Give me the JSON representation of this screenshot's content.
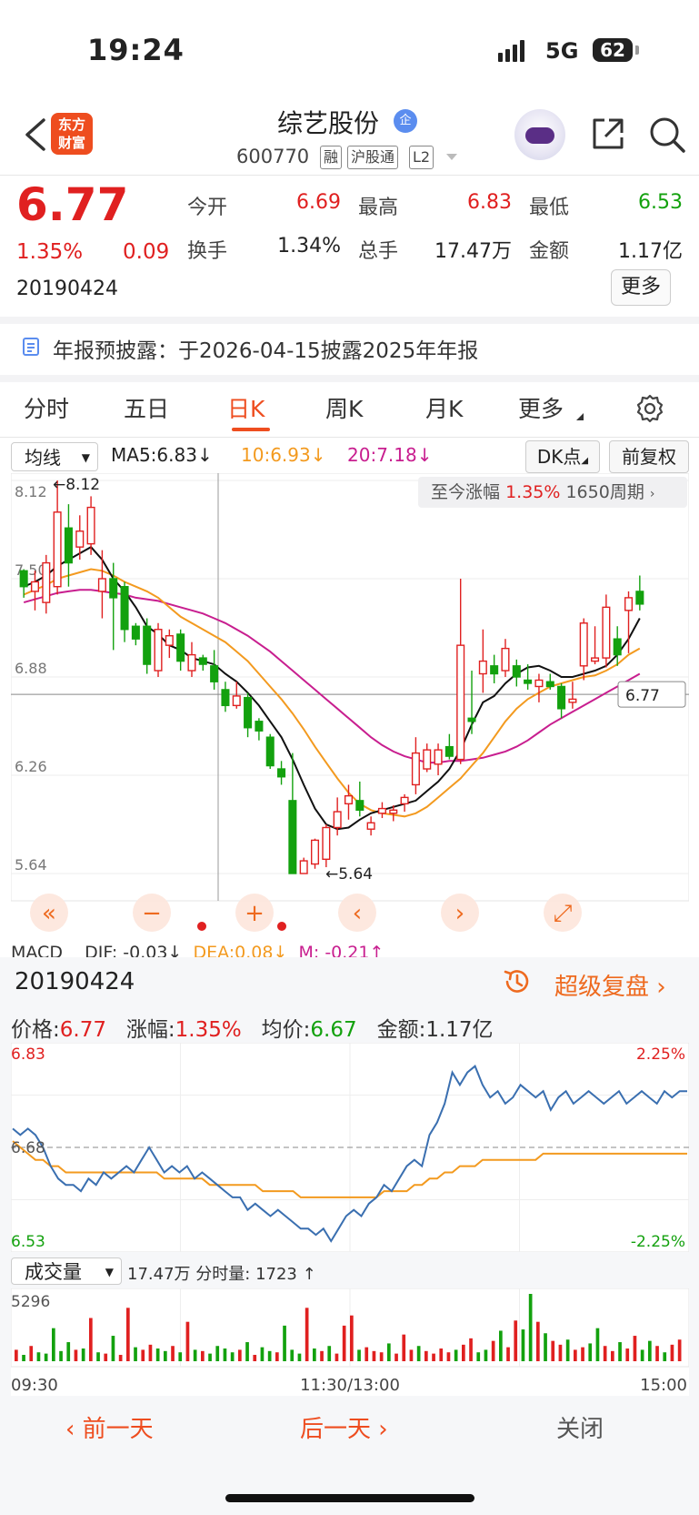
{
  "status": {
    "time": "19:24",
    "network": "5G",
    "battery": "62"
  },
  "header": {
    "stock_name": "综艺股份",
    "corp_badge": "企",
    "stock_code": "600770",
    "tags": [
      "融",
      "沪股通",
      "L2"
    ],
    "logo_line1": "东方",
    "logo_line2": "财富"
  },
  "quote": {
    "price": "6.77",
    "change_pct": "1.35%",
    "change": "0.09",
    "date": "20190424",
    "open_label": "今开",
    "open": "6.69",
    "high_label": "最高",
    "high": "6.83",
    "low_label": "最低",
    "low": "6.53",
    "turnover_label": "换手",
    "turnover": "1.34%",
    "volume_label": "总手",
    "volume": "17.47万",
    "amount_label": "金额",
    "amount": "1.17亿",
    "more": "更多"
  },
  "notice": "年报预披露：于2026-04-15披露2025年年报",
  "tabs": [
    "分时",
    "五日",
    "日K",
    "周K",
    "月K",
    "更多"
  ],
  "ma_bar": {
    "select": "均线",
    "ma5": "MA5:6.83",
    "ma10": "10:6.93",
    "ma20": "20:7.18",
    "dk": "DK点",
    "adjust": "前复权"
  },
  "since_box": {
    "label": "至今涨幅",
    "value": "1.35%",
    "periods": "1650周期"
  },
  "kline": {
    "y_ticks": [
      "8.12",
      "7.50",
      "6.88",
      "6.26",
      "5.64"
    ],
    "max_label": "8.12",
    "min_label": "5.64",
    "current_label": "6.77",
    "colors": {
      "up": "#e02020",
      "down": "#13a10e",
      "ma5": "#111111",
      "ma10": "#f39a1f",
      "ma20": "#c81e8f"
    }
  },
  "chart_data": {
    "type": "candlestick",
    "ylim": [
      5.64,
      8.12
    ],
    "ohlc": [
      [
        7.55,
        7.56,
        7.38,
        7.45
      ],
      [
        7.42,
        7.55,
        7.3,
        7.48
      ],
      [
        7.35,
        7.65,
        7.28,
        7.6
      ],
      [
        7.45,
        8.12,
        7.4,
        7.92
      ],
      [
        7.82,
        7.97,
        7.45,
        7.6
      ],
      [
        7.7,
        7.9,
        7.62,
        7.8
      ],
      [
        7.72,
        8.02,
        7.65,
        7.95
      ],
      [
        7.42,
        7.68,
        7.25,
        7.5
      ],
      [
        7.5,
        7.6,
        7.05,
        7.38
      ],
      [
        7.45,
        7.48,
        7.1,
        7.18
      ],
      [
        7.2,
        7.22,
        7.08,
        7.12
      ],
      [
        7.2,
        7.25,
        6.9,
        6.96
      ],
      [
        6.92,
        7.22,
        6.88,
        7.18
      ],
      [
        7.08,
        7.18,
        7.0,
        7.14
      ],
      [
        7.15,
        7.18,
        6.92,
        6.98
      ],
      [
        6.92,
        7.1,
        6.88,
        7.02
      ],
      [
        7.0,
        7.02,
        6.92,
        6.96
      ],
      [
        6.95,
        7.05,
        6.8,
        6.85
      ],
      [
        6.8,
        6.85,
        6.66,
        6.7
      ],
      [
        6.7,
        6.85,
        6.68,
        6.76
      ],
      [
        6.75,
        6.78,
        6.5,
        6.56
      ],
      [
        6.6,
        6.62,
        6.48,
        6.54
      ],
      [
        6.5,
        6.52,
        6.3,
        6.32
      ],
      [
        6.3,
        6.35,
        6.2,
        6.25
      ],
      [
        6.1,
        6.4,
        5.92,
        5.64
      ],
      [
        5.64,
        5.74,
        5.64,
        5.72
      ],
      [
        5.7,
        5.86,
        5.67,
        5.85
      ],
      [
        5.73,
        5.95,
        5.68,
        5.93
      ],
      [
        5.93,
        6.12,
        5.88,
        6.03
      ],
      [
        6.08,
        6.2,
        5.98,
        6.13
      ],
      [
        6.1,
        6.22,
        6.0,
        6.04
      ],
      [
        5.92,
        6.0,
        5.88,
        5.96
      ],
      [
        6.02,
        6.09,
        5.99,
        6.05
      ],
      [
        6.02,
        6.07,
        5.97,
        6.04
      ],
      [
        6.08,
        6.14,
        6.03,
        6.12
      ],
      [
        6.2,
        6.5,
        6.14,
        6.4
      ],
      [
        6.3,
        6.46,
        6.28,
        6.42
      ],
      [
        6.33,
        6.46,
        6.26,
        6.42
      ],
      [
        6.44,
        6.52,
        6.36,
        6.38
      ],
      [
        6.36,
        7.5,
        6.33,
        7.08
      ],
      [
        6.62,
        6.92,
        6.52,
        6.6
      ],
      [
        6.9,
        7.18,
        6.78,
        6.98
      ],
      [
        6.95,
        7.02,
        6.84,
        6.9
      ],
      [
        6.92,
        7.12,
        6.88,
        7.06
      ],
      [
        6.95,
        6.99,
        6.82,
        6.88
      ],
      [
        6.86,
        6.96,
        6.8,
        6.84
      ],
      [
        6.82,
        6.9,
        6.72,
        6.86
      ],
      [
        6.85,
        6.9,
        6.8,
        6.82
      ],
      [
        6.82,
        6.84,
        6.62,
        6.68
      ],
      [
        6.72,
        6.85,
        6.68,
        6.74
      ],
      [
        6.95,
        7.25,
        6.86,
        7.22
      ],
      [
        6.98,
        7.2,
        6.96,
        7.0
      ],
      [
        7.0,
        7.4,
        6.94,
        7.32
      ],
      [
        7.12,
        7.2,
        6.95,
        7.02
      ],
      [
        7.3,
        7.42,
        7.03,
        7.38
      ],
      [
        7.42,
        7.52,
        7.3,
        7.34
      ]
    ],
    "ma5": [
      7.45,
      7.48,
      7.52,
      7.58,
      7.62,
      7.66,
      7.7,
      7.62,
      7.5,
      7.42,
      7.32,
      7.2,
      7.15,
      7.08,
      7.05,
      7.0,
      6.98,
      6.96,
      6.9,
      6.85,
      6.78,
      6.7,
      6.6,
      6.5,
      6.36,
      6.2,
      6.05,
      5.95,
      5.92,
      5.93,
      5.98,
      6.02,
      6.04,
      6.06,
      6.08,
      6.1,
      6.16,
      6.22,
      6.3,
      6.42,
      6.58,
      6.72,
      6.76,
      6.84,
      6.9,
      6.94,
      6.95,
      6.92,
      6.88,
      6.88,
      6.9,
      6.92,
      6.95,
      7.02,
      7.12,
      7.25
    ],
    "ma10": [
      7.4,
      7.43,
      7.46,
      7.5,
      7.52,
      7.54,
      7.56,
      7.55,
      7.52,
      7.48,
      7.45,
      7.42,
      7.38,
      7.32,
      7.26,
      7.22,
      7.18,
      7.14,
      7.1,
      7.04,
      6.98,
      6.9,
      6.82,
      6.74,
      6.65,
      6.55,
      6.44,
      6.34,
      6.24,
      6.15,
      6.08,
      6.04,
      6.02,
      6.01,
      6.0,
      6.02,
      6.06,
      6.12,
      6.18,
      6.24,
      6.32,
      6.4,
      6.5,
      6.6,
      6.68,
      6.74,
      6.78,
      6.82,
      6.84,
      6.86,
      6.88,
      6.89,
      6.92,
      6.96,
      7.02,
      7.06
    ],
    "ma20": [
      7.35,
      7.37,
      7.39,
      7.41,
      7.42,
      7.43,
      7.43,
      7.42,
      7.41,
      7.4,
      7.38,
      7.37,
      7.36,
      7.34,
      7.32,
      7.3,
      7.28,
      7.25,
      7.22,
      7.18,
      7.14,
      7.09,
      7.04,
      6.98,
      6.92,
      6.86,
      6.8,
      6.74,
      6.68,
      6.62,
      6.56,
      6.5,
      6.45,
      6.41,
      6.38,
      6.36,
      6.34,
      6.34,
      6.35,
      6.35,
      6.36,
      6.37,
      6.39,
      6.41,
      6.44,
      6.48,
      6.53,
      6.58,
      6.62,
      6.66,
      6.7,
      6.74,
      6.78,
      6.82,
      6.86,
      6.9
    ]
  },
  "macd": {
    "label": "MACD",
    "dif": "DIF: -0.03↓",
    "dea": "DEA:0.08↓",
    "m": "M: -0.21↑"
  },
  "detail": {
    "date": "20190424",
    "replay": "超级复盘",
    "price_label": "价格:",
    "price": "6.77",
    "pct_label": "涨幅:",
    "pct": "1.35%",
    "avg_label": "均价:",
    "avg": "6.67",
    "amount_label": "金额:",
    "amount": "1.17亿",
    "intraday": {
      "high": "6.83",
      "mid": "6.68",
      "low": "6.53",
      "pct_high": "2.25%",
      "pct_low": "-2.25%",
      "price": [
        6.71,
        6.7,
        6.71,
        6.7,
        6.68,
        6.65,
        6.63,
        6.62,
        6.62,
        6.61,
        6.63,
        6.62,
        6.64,
        6.63,
        6.64,
        6.65,
        6.64,
        6.66,
        6.68,
        6.66,
        6.64,
        6.65,
        6.64,
        6.65,
        6.63,
        6.64,
        6.63,
        6.62,
        6.61,
        6.6,
        6.6,
        6.58,
        6.59,
        6.58,
        6.57,
        6.58,
        6.57,
        6.56,
        6.55,
        6.55,
        6.54,
        6.55,
        6.53,
        6.55,
        6.57,
        6.58,
        6.57,
        6.59,
        6.6,
        6.62,
        6.61,
        6.63,
        6.65,
        6.66,
        6.65,
        6.7,
        6.72,
        6.75,
        6.8,
        6.78,
        6.8,
        6.81,
        6.78,
        6.76,
        6.77,
        6.75,
        6.76,
        6.78,
        6.77,
        6.76,
        6.77,
        6.74,
        6.76,
        6.77,
        6.75,
        6.76,
        6.77,
        6.76,
        6.75,
        6.76,
        6.77,
        6.75,
        6.76,
        6.77,
        6.76,
        6.75,
        6.77,
        6.76,
        6.77,
        6.77
      ],
      "avg": [
        6.69,
        6.68,
        6.67,
        6.66,
        6.66,
        6.65,
        6.65,
        6.64,
        6.64,
        6.64,
        6.64,
        6.64,
        6.64,
        6.64,
        6.64,
        6.64,
        6.64,
        6.64,
        6.64,
        6.64,
        6.63,
        6.63,
        6.63,
        6.63,
        6.63,
        6.63,
        6.62,
        6.62,
        6.62,
        6.62,
        6.62,
        6.62,
        6.62,
        6.61,
        6.61,
        6.61,
        6.61,
        6.61,
        6.6,
        6.6,
        6.6,
        6.6,
        6.6,
        6.6,
        6.6,
        6.6,
        6.6,
        6.6,
        6.6,
        6.61,
        6.61,
        6.61,
        6.61,
        6.62,
        6.62,
        6.63,
        6.63,
        6.64,
        6.64,
        6.65,
        6.65,
        6.65,
        6.66,
        6.66,
        6.66,
        6.66,
        6.66,
        6.66,
        6.66,
        6.66,
        6.67,
        6.67,
        6.67,
        6.67,
        6.67,
        6.67,
        6.67,
        6.67,
        6.67,
        6.67,
        6.67,
        6.67,
        6.67,
        6.67,
        6.67,
        6.67,
        6.67,
        6.67,
        6.67,
        6.67
      ]
    },
    "volume": {
      "select": "成交量",
      "total": "17.47万",
      "minute_label": "分时量:",
      "minute": "1723",
      "max": "5296",
      "times": [
        "09:30",
        "11:30/13:00",
        "15:00"
      ],
      "bars": [
        900,
        500,
        1200,
        700,
        600,
        2600,
        800,
        1500,
        900,
        1000,
        3400,
        700,
        600,
        2000,
        500,
        4200,
        1100,
        900,
        1300,
        1000,
        800,
        1200,
        700,
        3100,
        900,
        800,
        600,
        1200,
        1000,
        700,
        900,
        1500,
        500,
        1100,
        800,
        700,
        2800,
        900,
        600,
        4200,
        1000,
        800,
        1200,
        600,
        2800,
        3600,
        900,
        1100,
        800,
        700,
        1400,
        600,
        2100,
        900,
        1200,
        800,
        600,
        1000,
        700,
        900,
        1300,
        1800,
        700,
        900,
        1600,
        2400,
        1100,
        3200,
        2500,
        5296,
        3100,
        2200,
        1600,
        1300,
        1700,
        900,
        1100,
        1400,
        2600,
        1200,
        800,
        1500,
        1000,
        2000,
        900,
        1600,
        1200,
        700,
        1300,
        1700
      ]
    }
  },
  "nav": {
    "prev": "前一天",
    "next": "后一天",
    "close": "关闭"
  }
}
